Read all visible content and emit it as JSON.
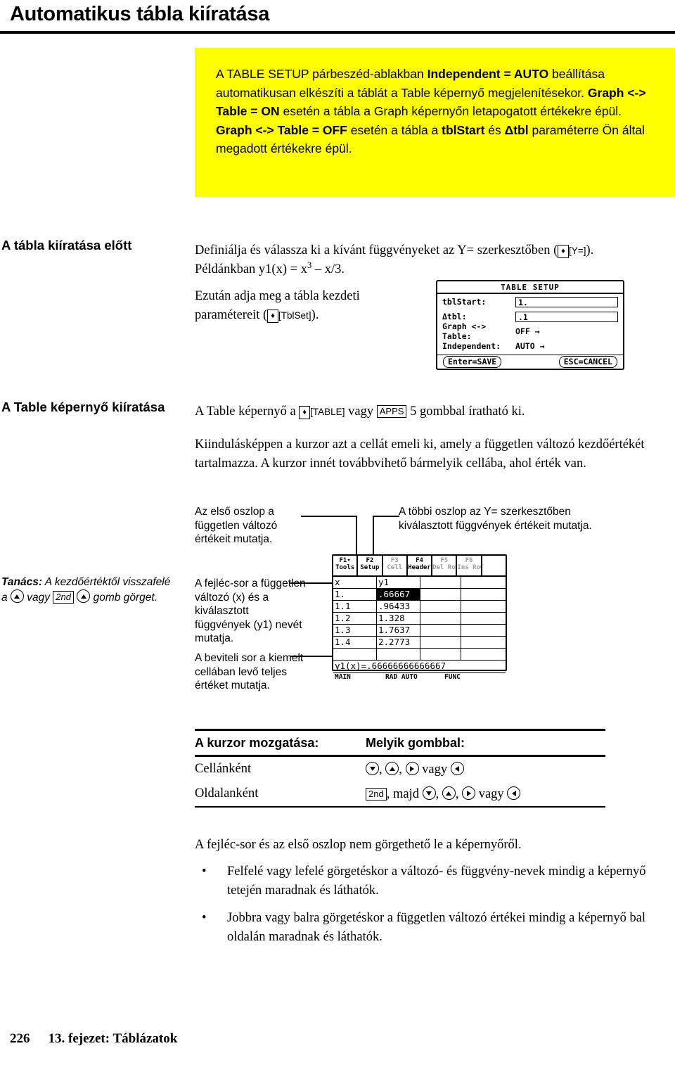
{
  "page": {
    "title": "Automatikus tábla kiíratása",
    "footer_page_number": "226",
    "footer_chapter": "13. fejezet: Táblázatok"
  },
  "callout": {
    "background_color": "#ffff00",
    "segments": [
      {
        "text": "A TABLE SETUP párbeszéd-ablakban ",
        "bold": false
      },
      {
        "text": "Independent",
        "bold": true
      },
      {
        "text": " = ",
        "bold": true
      },
      {
        "text": "AUTO",
        "bold": true
      },
      {
        "text": " beállítása automatikusan elkészíti a táblát a Table képernyő megjelenítésekor. ",
        "bold": false
      },
      {
        "text": "Graph <-> Table = ON",
        "bold": true
      },
      {
        "text": " esetén a tábla a Graph képernyőn letapogatott értékekre épül. ",
        "bold": false
      },
      {
        "text": "Graph <-> Table = OFF",
        "bold": true
      },
      {
        "text": " esetén a tábla a ",
        "bold": false
      },
      {
        "text": "tblStart",
        "bold": true
      },
      {
        "text": " és ",
        "bold": false
      },
      {
        "text": "Δtbl",
        "bold": true
      },
      {
        "text": " paraméterre Ön által megadott értékekre épül.",
        "bold": false
      }
    ],
    "full_text": "A TABLE SETUP párbeszéd-ablakban Independent = AUTO beállítása automatikusan elkészíti a táblát a Table képernyő megjelenítésekor. Graph <-> Table = ON esetén a tábla a Graph képernyőn letapogatott értékekre épül. Graph <-> Table = OFF esetén a tábla a tblStart és Δtbl paraméterre Ön által megadott értékekre épül."
  },
  "sections": [
    {
      "heading": "A tábla kiíratása előtt",
      "paragraph1_a": "Definiálja és válassza ki a kívánt függvényeket az Y= szerkesztőben (",
      "paragraph1_key_diamond": "♦",
      "paragraph1_key_label": "Y=",
      "paragraph1_b": "). Példánkban y1(x) = x",
      "paragraph1_exp": "3",
      "paragraph1_c": " – x/3.",
      "paragraph2_a": "Ezután adja meg a tábla kezdeti paramétereit (",
      "paragraph2_key_diamond": "♦",
      "paragraph2_key_label": "TblSet",
      "paragraph2_b": ")."
    },
    {
      "heading": "A Table képernyő kiíratása",
      "paragraph1_a": "A Table képernyő a ",
      "paragraph1_key_diamond": "♦",
      "paragraph1_key_label": "TABLE",
      "paragraph1_b": " vagy ",
      "paragraph1_key_apps": "APPS",
      "paragraph1_c": " 5 gombbal íratható ki.",
      "paragraph2": "Kiindulásképpen a kurzor azt a cellát emeli ki, amely a független változó kezdőértékét tartalmazza. A kurzor innét továbbvihető bármelyik cellába, ahol érték van."
    }
  ],
  "table_setup_screen": {
    "title": "TABLE SETUP",
    "rows": [
      {
        "label": "tblStart:",
        "value": "1.",
        "field": true
      },
      {
        "label": "Δtbl:",
        "value": ".1",
        "field": true
      },
      {
        "label": "Graph <-> Table:",
        "value": "OFF →",
        "field": false
      },
      {
        "label": "Independent:",
        "value": "AUTO →",
        "field": false
      }
    ],
    "footer_left": "Enter=SAVE",
    "footer_right": "ESC=CANCEL"
  },
  "table_screen": {
    "toolbar": [
      {
        "fkey": "F1▾",
        "name": "Tools",
        "dim": false
      },
      {
        "fkey": "F2",
        "name": "Setup",
        "dim": false
      },
      {
        "fkey": "F3",
        "name": "Cell",
        "dim": true
      },
      {
        "fkey": "F4",
        "name": "Header",
        "dim": false
      },
      {
        "fkey": "F5",
        "name": "Del Row",
        "dim": true
      },
      {
        "fkey": "F6",
        "name": "Ins Row",
        "dim": true
      },
      {
        "fkey": "",
        "name": "",
        "dim": true
      }
    ],
    "headers": [
      "x",
      "y1",
      "",
      ""
    ],
    "rows": [
      {
        "cells": [
          "1.",
          ".66667",
          "",
          ""
        ],
        "highlight_col": 1
      },
      {
        "cells": [
          "1.1",
          ".96433",
          "",
          ""
        ],
        "highlight_col": -1
      },
      {
        "cells": [
          "1.2",
          "1.328",
          "",
          ""
        ],
        "highlight_col": -1
      },
      {
        "cells": [
          "1.3",
          "1.7637",
          "",
          ""
        ],
        "highlight_col": -1
      },
      {
        "cells": [
          "1.4",
          "2.2773",
          "",
          ""
        ],
        "highlight_col": -1
      },
      {
        "cells": [
          "",
          "",
          "",
          ""
        ],
        "highlight_col": -1
      }
    ],
    "entry_line": "y1(x)=.66666666666667",
    "status": [
      "MAIN",
      "RAD AUTO",
      "FUNC"
    ]
  },
  "notes": {
    "first_column": "Az első oszlop a független változó értékeit mutatja.",
    "other_columns": "A többi oszlop az Y= szerkesztőben kiválasztott függvények értékeit mutatja.",
    "header_row": "A fejléc-sor a független változó (x) és a kiválasztott függvények (y1) nevét mutatja.",
    "entry_line": "A beviteli sor a kiemelt cellában levő teljes értéket mutatja."
  },
  "tip": {
    "label": "Tanács:",
    "text_a": " A kezdőértéktől visszafelé a ",
    "key_up_1": "up-arrow",
    "text_b": " vagy ",
    "key_2nd": "2nd",
    "key_up_2": "up-arrow",
    "text_c": " gomb görget."
  },
  "key_table": {
    "header": [
      "A kurzor mozgatása:",
      "Melyik gombbal:"
    ],
    "rows": [
      {
        "action": "Cellánként",
        "keys_text_parts": [
          ", ",
          ", ",
          " vagy "
        ],
        "keys": [
          "down-arrow",
          "up-arrow",
          "right-arrow",
          "left-arrow"
        ],
        "prefix": ""
      },
      {
        "action": "Oldalanként",
        "keys_text_parts": [
          ", ",
          ", ",
          " vagy "
        ],
        "keys": [
          "down-arrow",
          "up-arrow",
          "right-arrow",
          "left-arrow"
        ],
        "prefix": "2nd",
        "prefix_suffix": ", majd "
      }
    ]
  },
  "closing": {
    "paragraph": "A fejléc-sor és az első oszlop nem görgethető le a képernyőről.",
    "bullets": [
      "Felfelé vagy lefelé görgetéskor a változó- és függvény-nevek mindig a képernyő tetején maradnak és láthatók.",
      "Jobbra vagy balra görgetéskor a független változó értékei mindig a képernyő bal oldalán maradnak és láthatók."
    ],
    "bullet_char": "•"
  }
}
